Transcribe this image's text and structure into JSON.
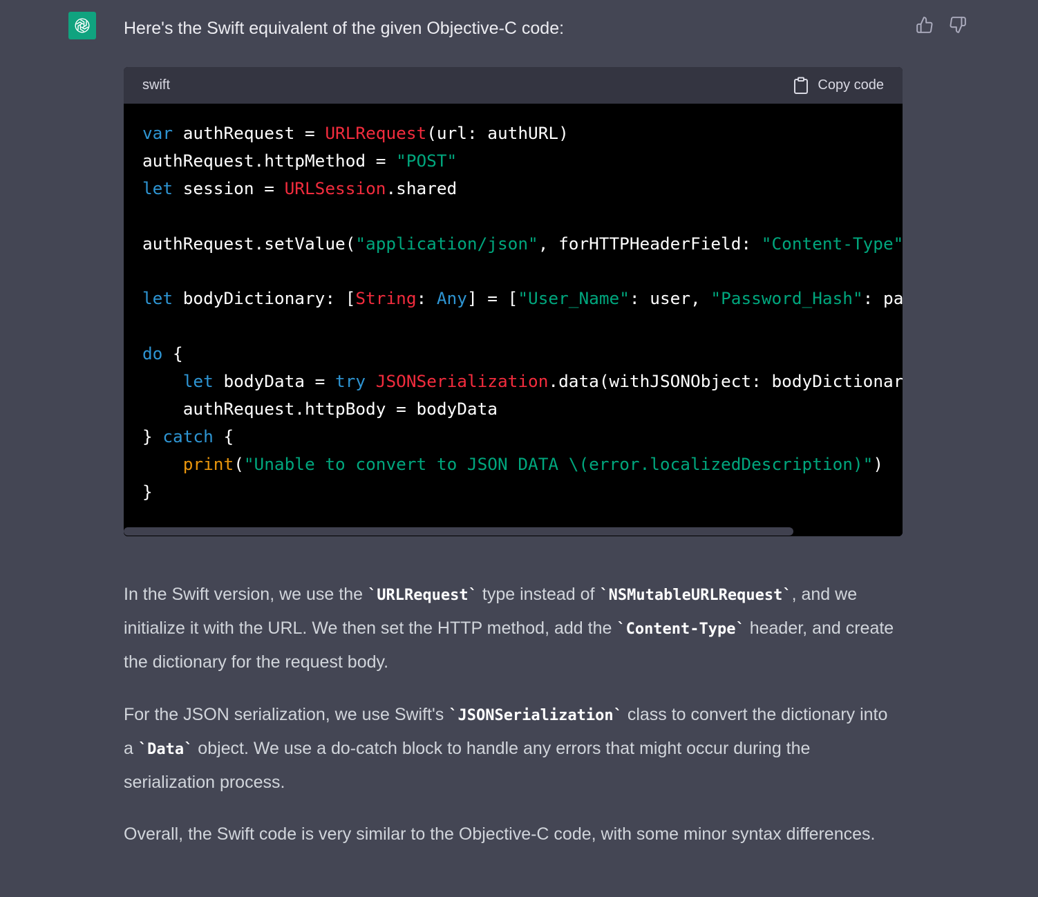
{
  "message": {
    "avatar_icon": "openai-logo-icon",
    "avatar_color": "#10a37f",
    "intro": "Here's the Swift equivalent of the given Objective-C code:",
    "feedback": {
      "thumbs_up_icon": "thumbs-up-icon",
      "thumbs_down_icon": "thumbs-down-icon"
    }
  },
  "code_block": {
    "language": "swift",
    "copy_label": "Copy code",
    "lines": [
      [
        {
          "t": "kw",
          "v": "var"
        },
        {
          "t": "p",
          "v": " authRequest = "
        },
        {
          "t": "ty",
          "v": "URLRequest"
        },
        {
          "t": "p",
          "v": "(url: authURL)"
        }
      ],
      [
        {
          "t": "p",
          "v": "authRequest.httpMethod = "
        },
        {
          "t": "st",
          "v": "\"POST\""
        }
      ],
      [
        {
          "t": "kw",
          "v": "let"
        },
        {
          "t": "p",
          "v": " session = "
        },
        {
          "t": "ty",
          "v": "URLSession"
        },
        {
          "t": "p",
          "v": ".shared"
        }
      ],
      [],
      [
        {
          "t": "p",
          "v": "authRequest.setValue("
        },
        {
          "t": "st",
          "v": "\"application/json\""
        },
        {
          "t": "p",
          "v": ", forHTTPHeaderField: "
        },
        {
          "t": "st",
          "v": "\"Content-Type\""
        },
        {
          "t": "p",
          "v": ")"
        }
      ],
      [],
      [
        {
          "t": "kw",
          "v": "let"
        },
        {
          "t": "p",
          "v": " bodyDictionary: ["
        },
        {
          "t": "ty",
          "v": "String"
        },
        {
          "t": "p",
          "v": ": "
        },
        {
          "t": "kw",
          "v": "Any"
        },
        {
          "t": "p",
          "v": "] = ["
        },
        {
          "t": "st",
          "v": "\"User_Name\""
        },
        {
          "t": "p",
          "v": ": user, "
        },
        {
          "t": "st",
          "v": "\"Password_Hash\""
        },
        {
          "t": "p",
          "v": ": passwo"
        }
      ],
      [],
      [
        {
          "t": "kw",
          "v": "do"
        },
        {
          "t": "p",
          "v": " {"
        }
      ],
      [
        {
          "t": "p",
          "v": "    "
        },
        {
          "t": "kw",
          "v": "let"
        },
        {
          "t": "p",
          "v": " bodyData = "
        },
        {
          "t": "kw",
          "v": "try"
        },
        {
          "t": "p",
          "v": " "
        },
        {
          "t": "ty",
          "v": "JSONSerialization"
        },
        {
          "t": "p",
          "v": ".data(withJSONObject: bodyDictionary, o"
        }
      ],
      [
        {
          "t": "p",
          "v": "    authRequest.httpBody = bodyData"
        }
      ],
      [
        {
          "t": "p",
          "v": "} "
        },
        {
          "t": "kw",
          "v": "catch"
        },
        {
          "t": "p",
          "v": " {"
        }
      ],
      [
        {
          "t": "p",
          "v": "    "
        },
        {
          "t": "fn",
          "v": "print"
        },
        {
          "t": "p",
          "v": "("
        },
        {
          "t": "st",
          "v": "\"Unable to convert to JSON DATA \\(error.localizedDescription)\""
        },
        {
          "t": "p",
          "v": ")"
        }
      ],
      [
        {
          "t": "p",
          "v": "}"
        }
      ]
    ],
    "scroll_fraction": 0.86
  },
  "explanation": [
    [
      {
        "text": "In the Swift version, we use the "
      },
      {
        "code": "`URLRequest`"
      },
      {
        "text": " type instead of "
      },
      {
        "code": "`NSMutableURLRequest`"
      },
      {
        "text": ", and we initialize it with the URL. We then set the HTTP method, add the "
      },
      {
        "code": "`Content-Type`"
      },
      {
        "text": " header, and create the dictionary for the request body."
      }
    ],
    [
      {
        "text": "For the JSON serialization, we use Swift's "
      },
      {
        "code": "`JSONSerialization`"
      },
      {
        "text": " class to convert the dictionary into a "
      },
      {
        "code": "`Data`"
      },
      {
        "text": " object. We use a do-catch block to handle any errors that might occur during the serialization process."
      }
    ],
    [
      {
        "text": "Overall, the Swift code is very similar to the Objective-C code, with some minor syntax differences."
      }
    ]
  ],
  "colors": {
    "background": "#444654",
    "code_header": "#343541",
    "code_background": "#000000",
    "keyword": "#2e95d3",
    "type": "#f22c3d",
    "string": "#00a67d",
    "function": "#e9950c"
  }
}
